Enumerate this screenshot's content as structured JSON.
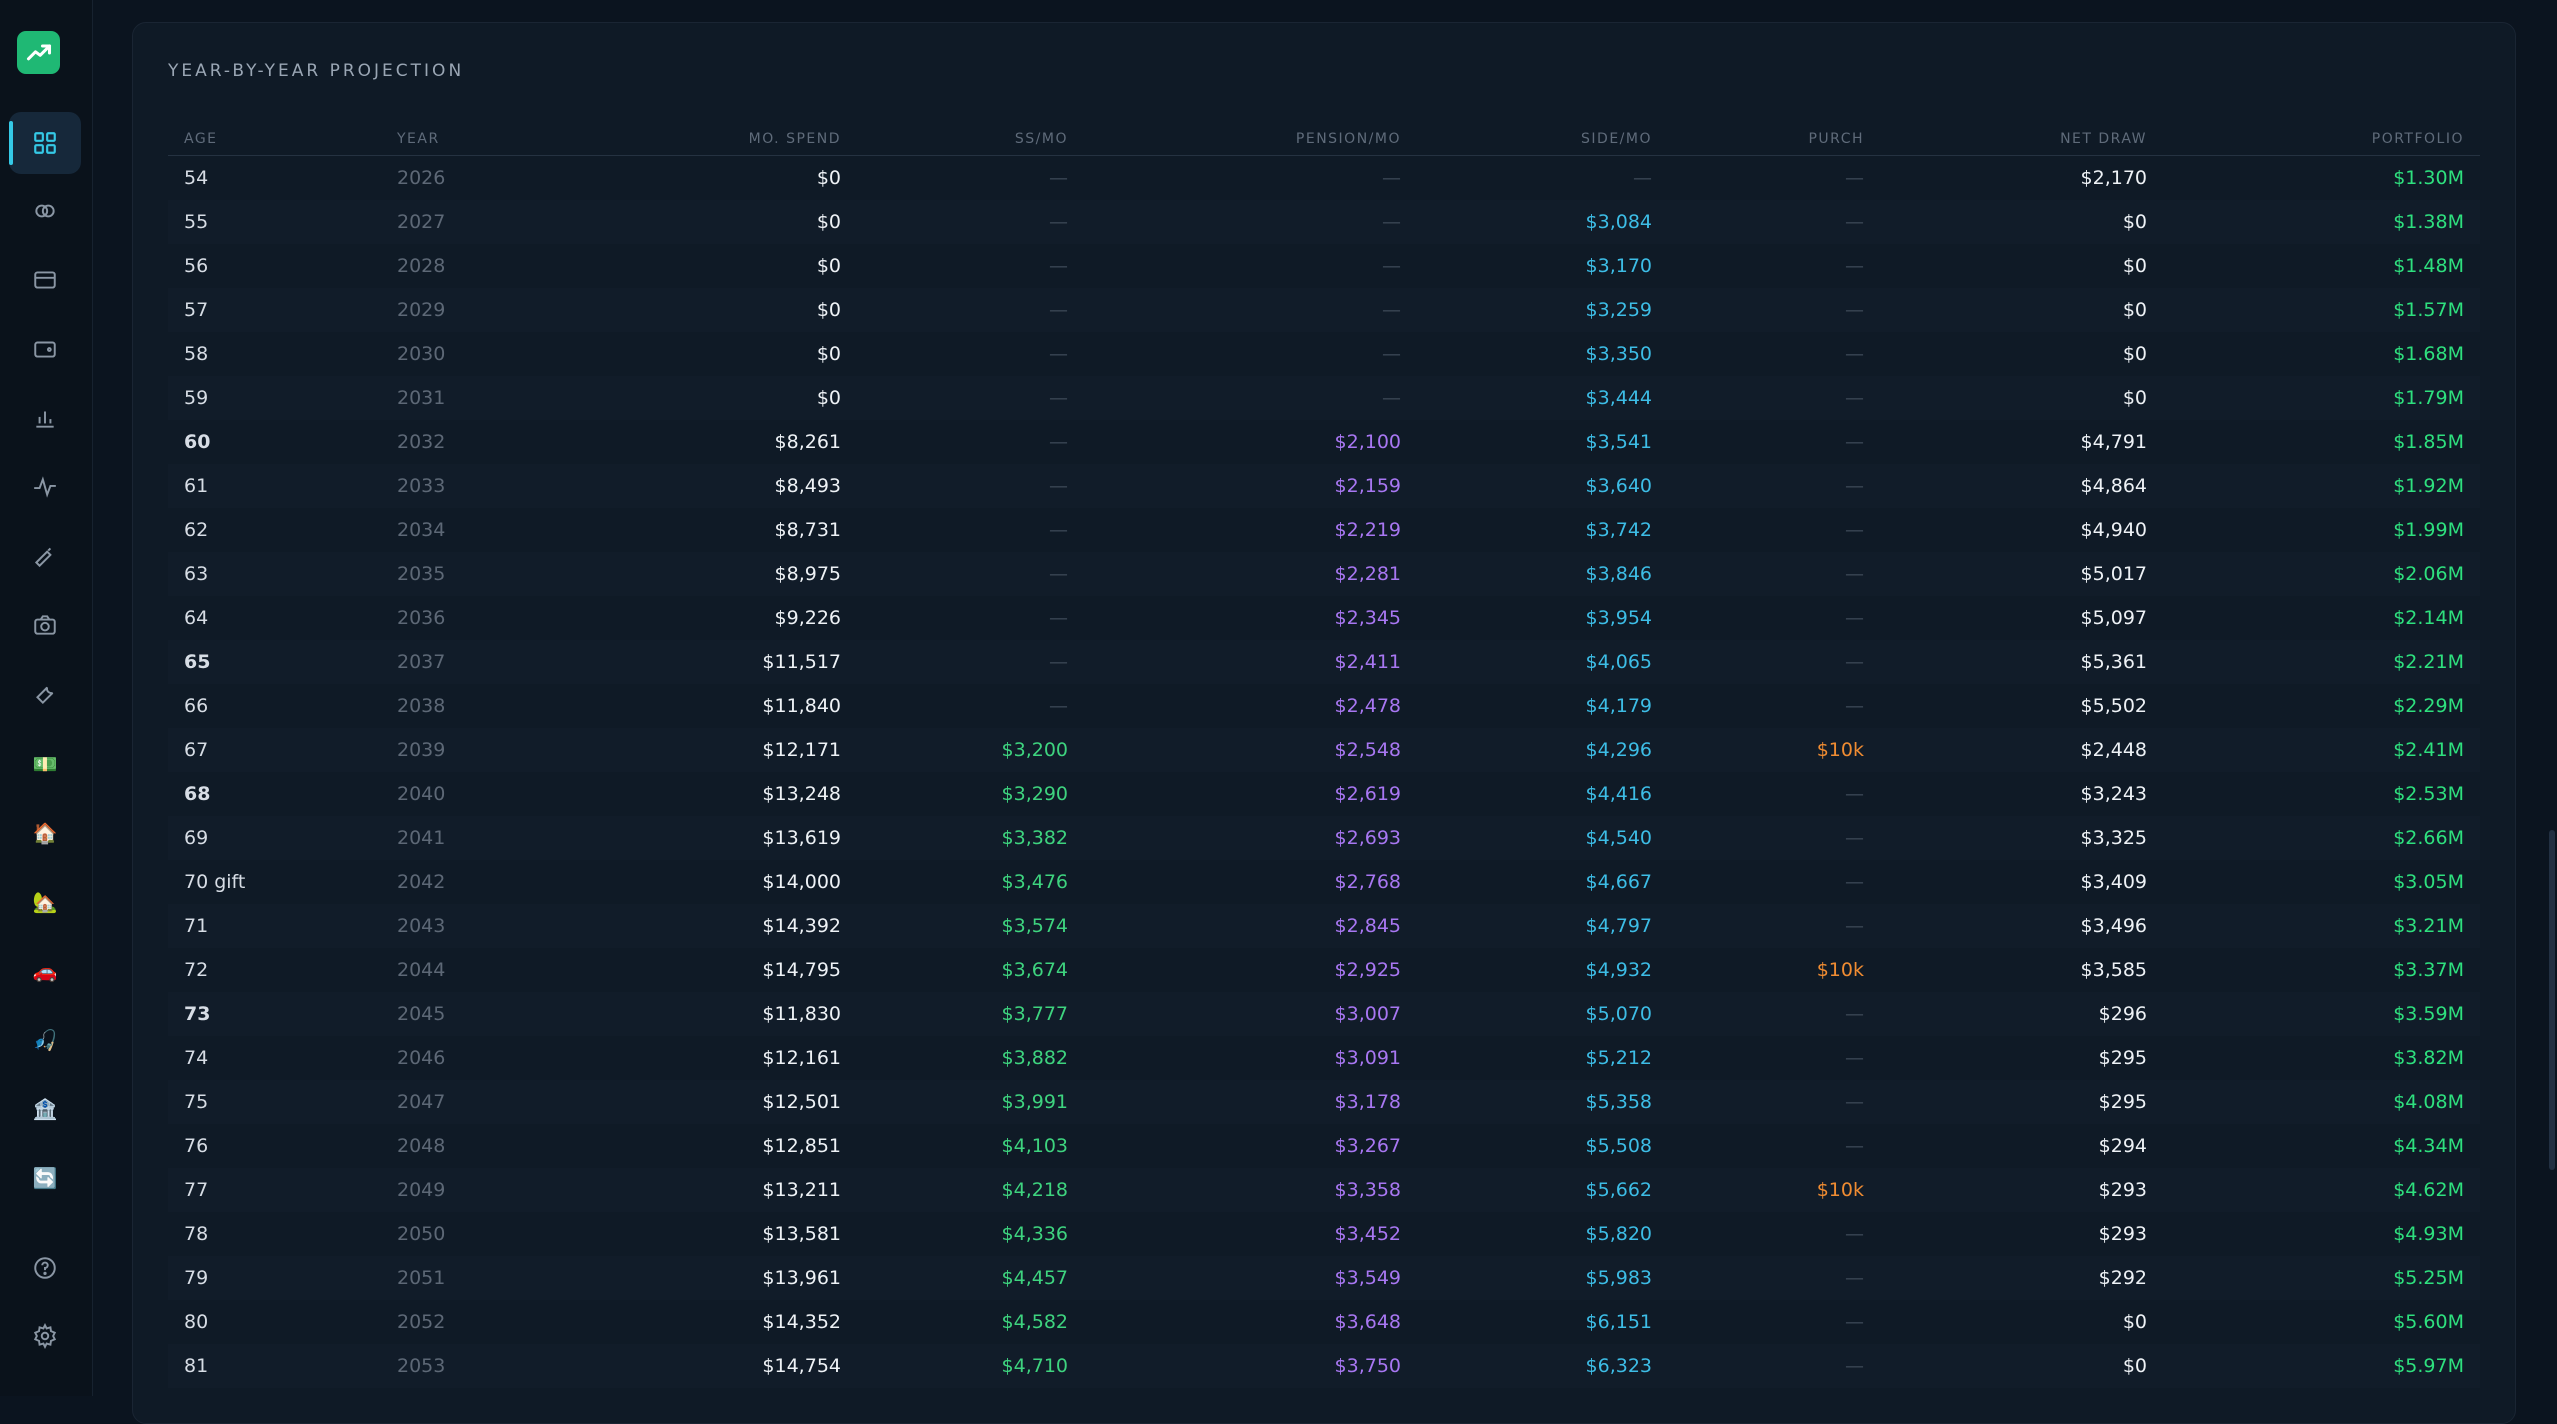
{
  "colors": {
    "ss": "#3ed47f",
    "pension": "#a877f2",
    "side": "#3dbde6",
    "purch": "#f08c32",
    "portfolio": "#2ee07e",
    "accent": "#35c9e6",
    "logo": "#1fb874"
  },
  "sidebar": {
    "items": [
      {
        "name": "dashboard-icon",
        "active": true
      },
      {
        "name": "rings-icon"
      },
      {
        "name": "credit-card-icon"
      },
      {
        "name": "wallet-icon"
      },
      {
        "name": "bar-chart-icon"
      },
      {
        "name": "activity-icon"
      },
      {
        "name": "pen-icon"
      },
      {
        "name": "camera-icon"
      },
      {
        "name": "wrench-icon"
      },
      {
        "name": "money-emoji-icon",
        "glyph": "💵"
      },
      {
        "name": "house-emoji-icon",
        "glyph": "🏠"
      },
      {
        "name": "house-garden-emoji-icon",
        "glyph": "🏡"
      },
      {
        "name": "car-emoji-icon",
        "glyph": "🚗"
      },
      {
        "name": "fishing-emoji-icon",
        "glyph": "🎣"
      },
      {
        "name": "bank-emoji-icon",
        "glyph": "🏦"
      },
      {
        "name": "refresh-emoji-icon",
        "glyph": "🔄"
      }
    ],
    "bottom": [
      {
        "name": "help-icon"
      },
      {
        "name": "settings-icon"
      }
    ]
  },
  "card": {
    "title": "YEAR-BY-YEAR PROJECTION",
    "columns": [
      "AGE",
      "YEAR",
      "MO. SPEND",
      "SS/MO",
      "PENSION/MO",
      "SIDE/MO",
      "PURCH",
      "NET DRAW",
      "PORTFOLIO"
    ],
    "rows": [
      {
        "age": "54",
        "year": "2026",
        "spend": "$0",
        "ss": "—",
        "pension": "—",
        "side": "—",
        "purch": "—",
        "draw": "$2,170",
        "portfolio": "$1.30M"
      },
      {
        "age": "55",
        "year": "2027",
        "spend": "$0",
        "ss": "—",
        "pension": "—",
        "side": "$3,084",
        "purch": "—",
        "draw": "$0",
        "portfolio": "$1.38M"
      },
      {
        "age": "56",
        "year": "2028",
        "spend": "$0",
        "ss": "—",
        "pension": "—",
        "side": "$3,170",
        "purch": "—",
        "draw": "$0",
        "portfolio": "$1.48M"
      },
      {
        "age": "57",
        "year": "2029",
        "spend": "$0",
        "ss": "—",
        "pension": "—",
        "side": "$3,259",
        "purch": "—",
        "draw": "$0",
        "portfolio": "$1.57M"
      },
      {
        "age": "58",
        "year": "2030",
        "spend": "$0",
        "ss": "—",
        "pension": "—",
        "side": "$3,350",
        "purch": "—",
        "draw": "$0",
        "portfolio": "$1.68M"
      },
      {
        "age": "59",
        "year": "2031",
        "spend": "$0",
        "ss": "—",
        "pension": "—",
        "side": "$3,444",
        "purch": "—",
        "draw": "$0",
        "portfolio": "$1.79M"
      },
      {
        "age": "60",
        "year": "2032",
        "spend": "$8,261",
        "ss": "—",
        "pension": "$2,100",
        "side": "$3,541",
        "purch": "—",
        "draw": "$4,791",
        "portfolio": "$1.85M",
        "bold": true
      },
      {
        "age": "61",
        "year": "2033",
        "spend": "$8,493",
        "ss": "—",
        "pension": "$2,159",
        "side": "$3,640",
        "purch": "—",
        "draw": "$4,864",
        "portfolio": "$1.92M"
      },
      {
        "age": "62",
        "year": "2034",
        "spend": "$8,731",
        "ss": "—",
        "pension": "$2,219",
        "side": "$3,742",
        "purch": "—",
        "draw": "$4,940",
        "portfolio": "$1.99M"
      },
      {
        "age": "63",
        "year": "2035",
        "spend": "$8,975",
        "ss": "—",
        "pension": "$2,281",
        "side": "$3,846",
        "purch": "—",
        "draw": "$5,017",
        "portfolio": "$2.06M"
      },
      {
        "age": "64",
        "year": "2036",
        "spend": "$9,226",
        "ss": "—",
        "pension": "$2,345",
        "side": "$3,954",
        "purch": "—",
        "draw": "$5,097",
        "portfolio": "$2.14M"
      },
      {
        "age": "65",
        "year": "2037",
        "spend": "$11,517",
        "ss": "—",
        "pension": "$2,411",
        "side": "$4,065",
        "purch": "—",
        "draw": "$5,361",
        "portfolio": "$2.21M",
        "bold": true
      },
      {
        "age": "66",
        "year": "2038",
        "spend": "$11,840",
        "ss": "—",
        "pension": "$2,478",
        "side": "$4,179",
        "purch": "—",
        "draw": "$5,502",
        "portfolio": "$2.29M"
      },
      {
        "age": "67",
        "year": "2039",
        "spend": "$12,171",
        "ss": "$3,200",
        "pension": "$2,548",
        "side": "$4,296",
        "purch": "$10k",
        "draw": "$2,448",
        "portfolio": "$2.41M"
      },
      {
        "age": "68",
        "year": "2040",
        "spend": "$13,248",
        "ss": "$3,290",
        "pension": "$2,619",
        "side": "$4,416",
        "purch": "—",
        "draw": "$3,243",
        "portfolio": "$2.53M",
        "bold": true
      },
      {
        "age": "69",
        "year": "2041",
        "spend": "$13,619",
        "ss": "$3,382",
        "pension": "$2,693",
        "side": "$4,540",
        "purch": "—",
        "draw": "$3,325",
        "portfolio": "$2.66M"
      },
      {
        "age": "70 gift",
        "year": "2042",
        "spend": "$14,000",
        "ss": "$3,476",
        "pension": "$2,768",
        "side": "$4,667",
        "purch": "—",
        "draw": "$3,409",
        "portfolio": "$3.05M"
      },
      {
        "age": "71",
        "year": "2043",
        "spend": "$14,392",
        "ss": "$3,574",
        "pension": "$2,845",
        "side": "$4,797",
        "purch": "—",
        "draw": "$3,496",
        "portfolio": "$3.21M"
      },
      {
        "age": "72",
        "year": "2044",
        "spend": "$14,795",
        "ss": "$3,674",
        "pension": "$2,925",
        "side": "$4,932",
        "purch": "$10k",
        "draw": "$3,585",
        "portfolio": "$3.37M"
      },
      {
        "age": "73",
        "year": "2045",
        "spend": "$11,830",
        "ss": "$3,777",
        "pension": "$3,007",
        "side": "$5,070",
        "purch": "—",
        "draw": "$296",
        "portfolio": "$3.59M",
        "bold": true
      },
      {
        "age": "74",
        "year": "2046",
        "spend": "$12,161",
        "ss": "$3,882",
        "pension": "$3,091",
        "side": "$5,212",
        "purch": "—",
        "draw": "$295",
        "portfolio": "$3.82M"
      },
      {
        "age": "75",
        "year": "2047",
        "spend": "$12,501",
        "ss": "$3,991",
        "pension": "$3,178",
        "side": "$5,358",
        "purch": "—",
        "draw": "$295",
        "portfolio": "$4.08M"
      },
      {
        "age": "76",
        "year": "2048",
        "spend": "$12,851",
        "ss": "$4,103",
        "pension": "$3,267",
        "side": "$5,508",
        "purch": "—",
        "draw": "$294",
        "portfolio": "$4.34M"
      },
      {
        "age": "77",
        "year": "2049",
        "spend": "$13,211",
        "ss": "$4,218",
        "pension": "$3,358",
        "side": "$5,662",
        "purch": "$10k",
        "draw": "$293",
        "portfolio": "$4.62M"
      },
      {
        "age": "78",
        "year": "2050",
        "spend": "$13,581",
        "ss": "$4,336",
        "pension": "$3,452",
        "side": "$5,820",
        "purch": "—",
        "draw": "$293",
        "portfolio": "$4.93M"
      },
      {
        "age": "79",
        "year": "2051",
        "spend": "$13,961",
        "ss": "$4,457",
        "pension": "$3,549",
        "side": "$5,983",
        "purch": "—",
        "draw": "$292",
        "portfolio": "$5.25M"
      },
      {
        "age": "80",
        "year": "2052",
        "spend": "$14,352",
        "ss": "$4,582",
        "pension": "$3,648",
        "side": "$6,151",
        "purch": "—",
        "draw": "$0",
        "portfolio": "$5.60M"
      },
      {
        "age": "81",
        "year": "2053",
        "spend": "$14,754",
        "ss": "$4,710",
        "pension": "$3,750",
        "side": "$6,323",
        "purch": "—",
        "draw": "$0",
        "portfolio": "$5.97M"
      }
    ]
  }
}
